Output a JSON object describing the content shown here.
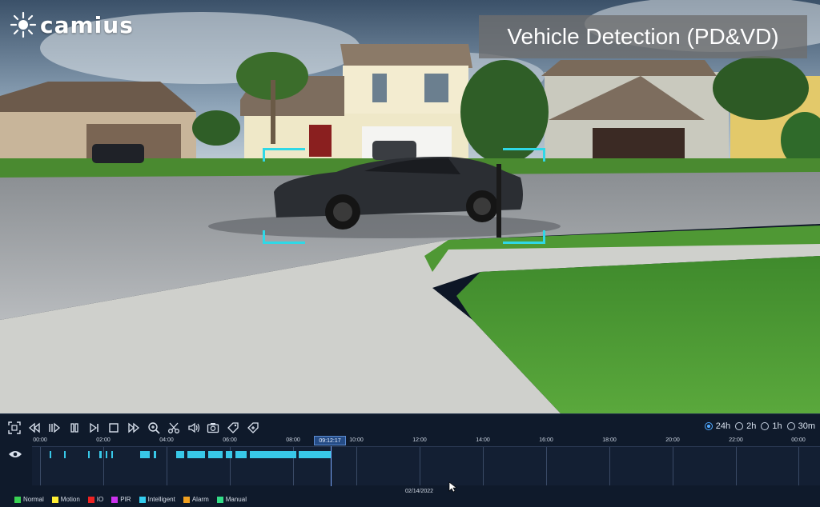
{
  "app": {
    "logo_text": "camius"
  },
  "overlay": {
    "title": "Vehicle Detection (PD&VD)",
    "box_color": "#2fd8e6"
  },
  "controls": [
    {
      "name": "fullscreen-icon"
    },
    {
      "name": "rewind-icon"
    },
    {
      "name": "reverse-play-icon"
    },
    {
      "name": "pause-icon"
    },
    {
      "name": "step-forward-icon"
    },
    {
      "name": "stop-icon"
    },
    {
      "name": "fast-forward-icon"
    },
    {
      "name": "zoom-icon"
    },
    {
      "name": "clip-icon"
    },
    {
      "name": "volume-icon"
    },
    {
      "name": "snapshot-icon"
    },
    {
      "name": "tag-icon"
    },
    {
      "name": "custom-tag-icon"
    }
  ],
  "timespan": {
    "selected": "24h",
    "options": [
      "24h",
      "2h",
      "1h",
      "30m"
    ]
  },
  "timeline": {
    "hours": [
      "00:00",
      "02:00",
      "04:00",
      "06:00",
      "08:00",
      "10:00",
      "12:00",
      "14:00",
      "16:00",
      "18:00",
      "20:00",
      "22:00",
      "00:00"
    ],
    "current_time": "09:12:17",
    "date": "02/14/2022",
    "accent": "#38c8e8"
  },
  "legend": [
    {
      "label": "Normal",
      "color": "#39d353"
    },
    {
      "label": "Motion",
      "color": "#ffee33"
    },
    {
      "label": "IO",
      "color": "#ee2222"
    },
    {
      "label": "PIR",
      "color": "#cc33ee"
    },
    {
      "label": "Intelligent",
      "color": "#33ccee"
    },
    {
      "label": "Alarm",
      "color": "#f0a020"
    },
    {
      "label": "Manual",
      "color": "#33dd88"
    }
  ]
}
